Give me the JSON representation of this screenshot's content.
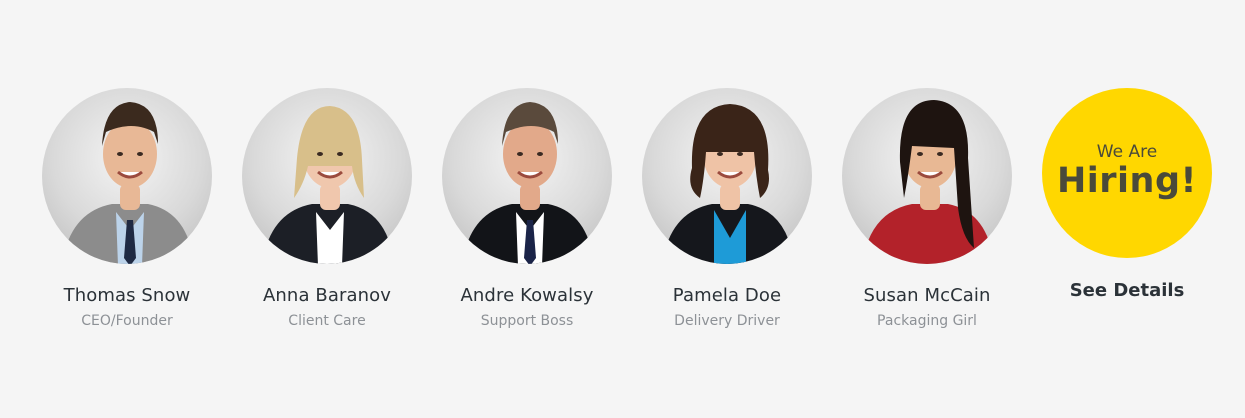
{
  "team": [
    {
      "name": "Thomas Snow",
      "role": "CEO/Founder",
      "photo": "man-gray-suit-portrait",
      "colors": {
        "hair": "#3b2a1e",
        "skin": "#e8b896",
        "jacket": "#8c8c8c",
        "shirt": "#bcd3ea",
        "tie": "#1f2a44"
      }
    },
    {
      "name": "Anna Baranov",
      "role": "Client Care",
      "photo": "blonde-woman-black-blazer-portrait",
      "colors": {
        "hair": "#d8bf8a",
        "skin": "#f0c7ad",
        "jacket": "#1c1f26",
        "shirt": "#ffffff",
        "tie": "#ffffff"
      }
    },
    {
      "name": "Andre Kowalsy",
      "role": "Support Boss",
      "photo": "older-man-dark-suit-portrait",
      "colors": {
        "hair": "#5a4a3c",
        "skin": "#e2a98a",
        "jacket": "#121418",
        "shirt": "#ffffff",
        "tie": "#1b2448"
      }
    },
    {
      "name": "Pamela Doe",
      "role": "Delivery Driver",
      "photo": "curly-hair-woman-blue-blouse-portrait",
      "colors": {
        "hair": "#3a2418",
        "skin": "#efc3a6",
        "jacket": "#15171c",
        "shirt": "#1e9bd7",
        "tie": "#1e9bd7"
      }
    },
    {
      "name": "Susan McCain",
      "role": "Packaging Girl",
      "photo": "woman-red-plaid-shirt-portrait",
      "colors": {
        "hair": "#1e1410",
        "skin": "#e8b894",
        "jacket": "#b3222a",
        "shirt": "#b3222a",
        "tie": "#b3222a"
      }
    }
  ],
  "hiring": {
    "line1": "We Are",
    "line2": "Hiring!",
    "link": "See Details",
    "color": "#ffd700"
  }
}
